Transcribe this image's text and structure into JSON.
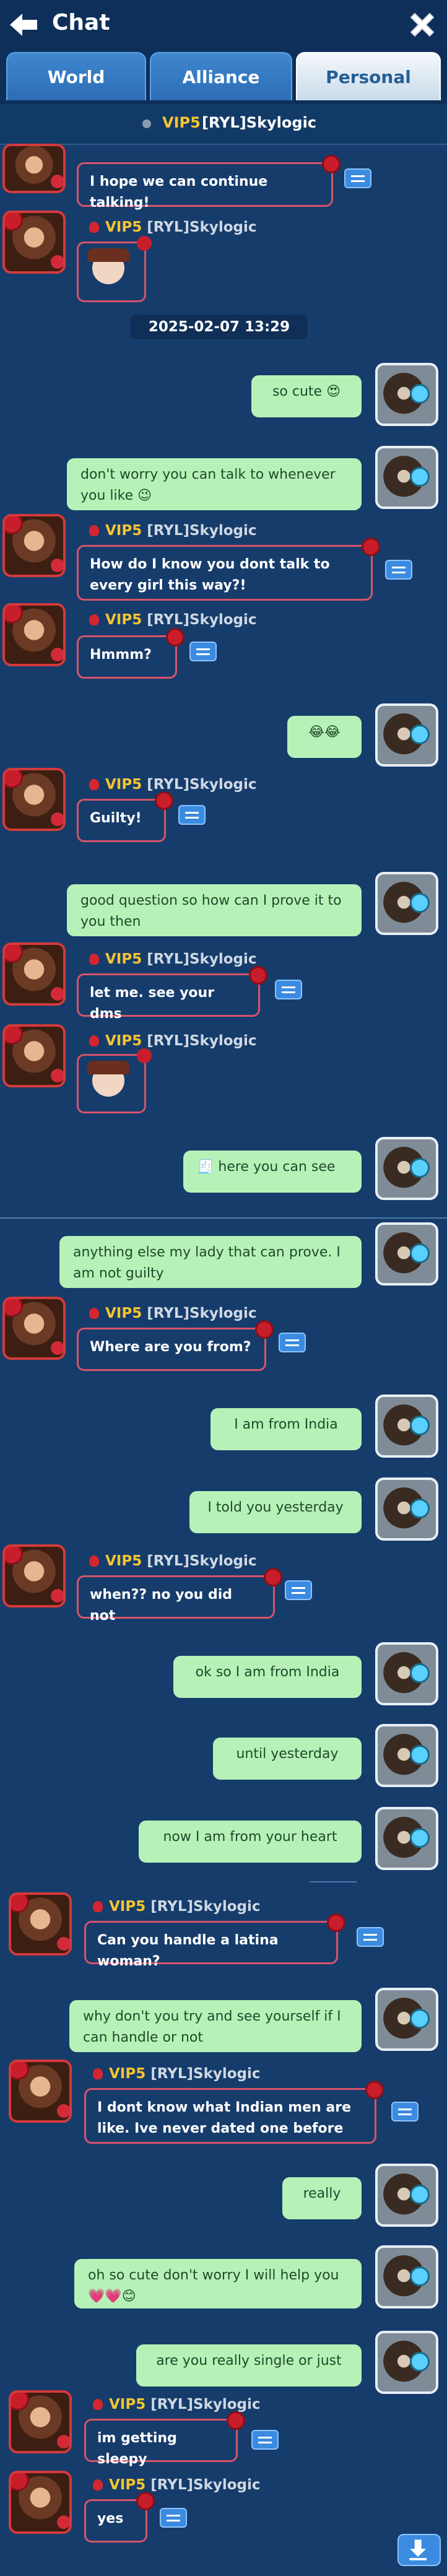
{
  "header": {
    "title": "Chat",
    "tabs": [
      "World",
      "Alliance",
      "Personal"
    ]
  },
  "conversation": {
    "vip": "VIP5",
    "name": "[RYL]Skylogic"
  },
  "timestamp": "2025-02-07 13:29",
  "sender": {
    "vip": "VIP5",
    "name": "[RYL]Skylogic"
  },
  "messages": {
    "m1": "I hope we can continue talking!",
    "m2": "so cute 😍",
    "m3": "don't worry you can talk to whenever you like 😉",
    "m4": "How do I know you dont talk to every girl this way?!",
    "m5": "Hmmm?",
    "m6": "😂😂",
    "m7": "Guilty!",
    "m8": "good question so how can I prove it to you then",
    "m9": "let me. see your dms",
    "m10": "🧾 here you can see",
    "m11": "anything else my lady that can prove. I am not guilty",
    "m12": "Where are you from?",
    "m13": "I am from India",
    "m14": "I told you yesterday",
    "m15": "when?? no you did not",
    "m16": "ok so I am from India",
    "m17": "until yesterday",
    "m18": "now I am from your heart",
    "m19": "Can you handle a latina woman?",
    "m20": "why don't you try and see  yourself if I can handle or not",
    "m21": "I dont know what Indian men are like. Ive never dated one before",
    "m22": "really",
    "m23": "oh so cute don't worry I will help you 💗💗😊",
    "m24": "are you really single or just",
    "m25": "im getting sleepy",
    "m26": "yes"
  },
  "colors": {
    "background": "#163c6b",
    "outgoing": "#b6f2b7",
    "vip": "#f4c430",
    "incoming_border": "#d7546a"
  },
  "icons": {
    "back": "back-arrow-icon",
    "close": "close-x-icon",
    "translate": "translate-icon",
    "download": "scroll-down-icon"
  }
}
